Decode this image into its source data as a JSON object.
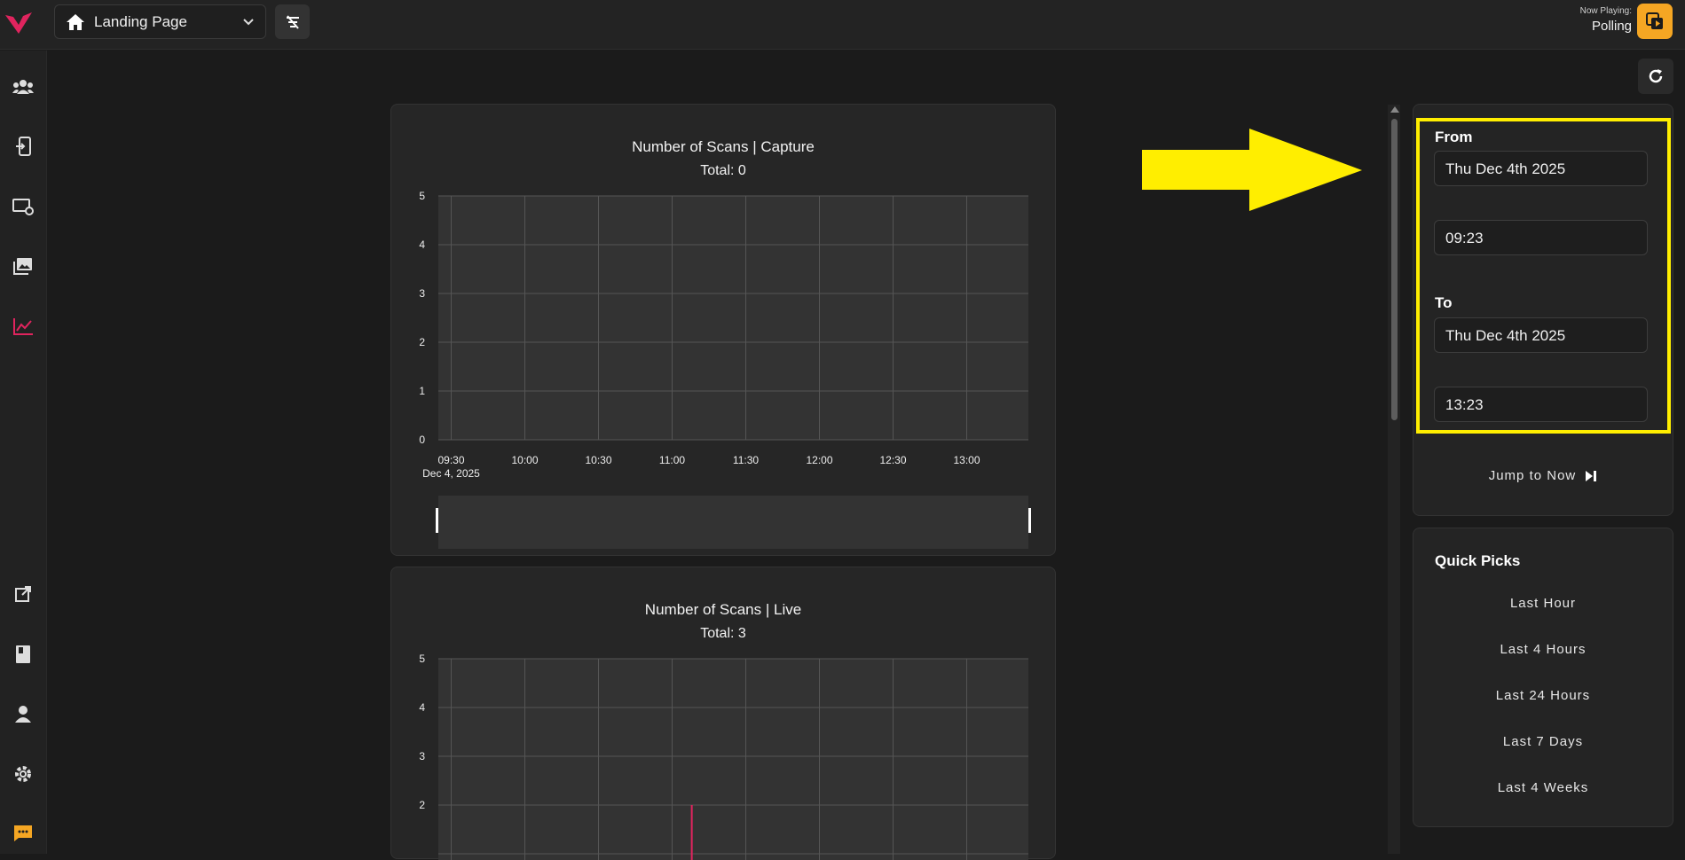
{
  "header": {
    "page_select_label": "Landing Page",
    "now_playing_label": "Now Playing:",
    "now_playing_value": "Polling"
  },
  "colors": {
    "accent": "#e0245e",
    "highlight": "#ffee00",
    "now_playing_btn": "#f5a623"
  },
  "sidebar": {
    "top_icons": [
      "users-icon",
      "device-login-icon",
      "display-settings-icon",
      "gallery-icon",
      "analytics-chart-icon"
    ],
    "bottom_icons": [
      "external-link-icon",
      "book-icon",
      "person-icon",
      "settings-icon",
      "chat-icon"
    ],
    "active": "analytics-chart-icon"
  },
  "charts": [
    {
      "title": "Number of Scans | Capture",
      "total": "Total: 0"
    },
    {
      "title": "Number of Scans | Live",
      "total": "Total: 3"
    }
  ],
  "chart_data": [
    {
      "type": "bar",
      "title": "Number of Scans | Capture",
      "subtitle": "Total: 0",
      "y_ticks": [
        "0",
        "1",
        "2",
        "3",
        "4",
        "5"
      ],
      "x_ticks": [
        "09:30",
        "10:00",
        "10:30",
        "11:00",
        "11:30",
        "12:00",
        "12:30",
        "13:00"
      ],
      "x_sub_label": "Dec 4, 2025",
      "ylim": [
        0,
        5
      ],
      "grid": true,
      "values": []
    },
    {
      "type": "bar",
      "title": "Number of Scans | Live",
      "subtitle": "Total: 3",
      "y_ticks": [
        "2",
        "3",
        "4",
        "5"
      ],
      "ylim": [
        0,
        5
      ],
      "grid": true,
      "x": [
        "11:08"
      ],
      "values": [
        2
      ]
    }
  ],
  "range": {
    "from_label": "From",
    "from_date": "Thu Dec 4th 2025",
    "from_time": "09:23",
    "to_label": "To",
    "to_date": "Thu Dec 4th 2025",
    "to_time": "13:23",
    "jump_label": "Jump to Now"
  },
  "quick_picks": {
    "title": "Quick Picks",
    "items": [
      "Last Hour",
      "Last 4 Hours",
      "Last 24 Hours",
      "Last 7 Days",
      "Last 4 Weeks"
    ]
  }
}
